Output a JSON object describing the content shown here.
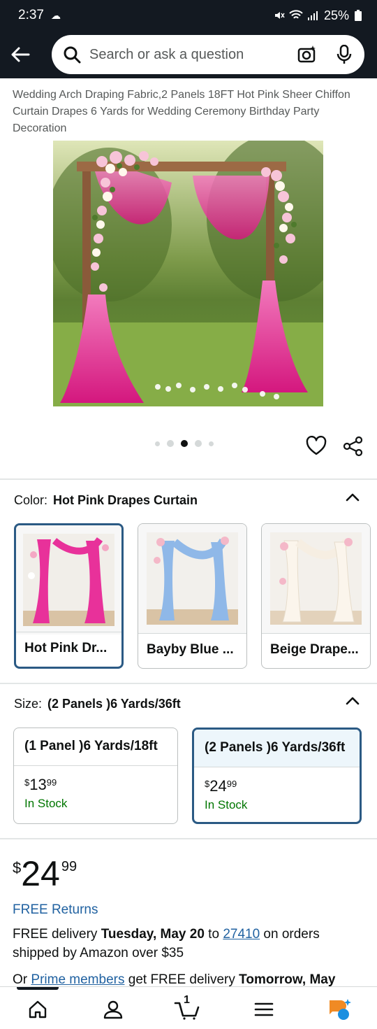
{
  "status_bar": {
    "time": "2:37",
    "battery": "25%"
  },
  "search": {
    "placeholder": "Search or ask a question"
  },
  "product": {
    "title": "Wedding Arch Draping Fabric,2 Panels 18FT Hot Pink Sheer Chiffon Curtain Drapes 6 Yards for Wedding Ceremony Birthday Party Decoration",
    "image_count": 5,
    "active_image": 3
  },
  "color_section": {
    "label": "Color:",
    "selected": "Hot Pink Drapes Curtain",
    "options": [
      {
        "label": "Hot Pink Dr...",
        "selected": true,
        "drape_color": "#e8319a"
      },
      {
        "label": "Bayby Blue ...",
        "selected": false,
        "drape_color": "#8fb8e8"
      },
      {
        "label": "Beige Drape...",
        "selected": false,
        "drape_color": "#efe6d8"
      }
    ]
  },
  "size_section": {
    "label": "Size:",
    "selected": "(2 Panels )6 Yards/36ft",
    "options": [
      {
        "label": "(1 Panel )6 Yards/18ft",
        "currency": "$",
        "whole": "13",
        "cents": "99",
        "stock": "In Stock",
        "selected": false
      },
      {
        "label": "(2 Panels )6 Yards/36ft",
        "currency": "$",
        "whole": "24",
        "cents": "99",
        "stock": "In Stock",
        "selected": true
      }
    ]
  },
  "price": {
    "currency": "$",
    "whole": "24",
    "cents": "99"
  },
  "returns": "FREE Returns",
  "delivery": {
    "prefix": "FREE delivery ",
    "date": "Tuesday, May 20",
    "to": " to ",
    "zip": "27410",
    "suffix": " on orders shipped by Amazon over $35"
  },
  "prime": {
    "prefix": "Or ",
    "link": "Prime members",
    "middle": " get FREE delivery ",
    "date": "Tomorrow, May"
  },
  "bottom_nav": {
    "cart_count": "1"
  },
  "colors": {
    "header_bg": "#131921",
    "link": "#2162a1",
    "in_stock": "#007600",
    "selected_border": "#2b5a84"
  }
}
